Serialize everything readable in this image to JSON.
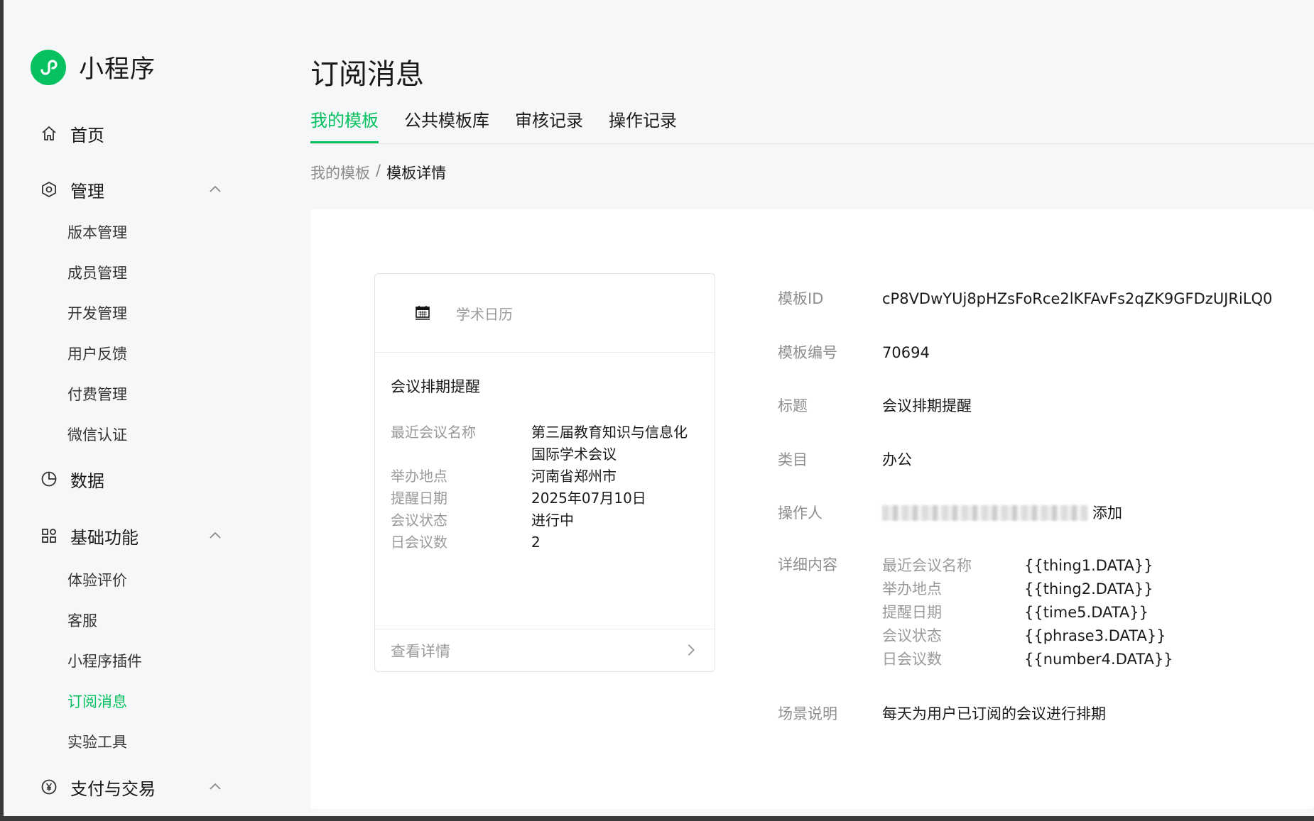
{
  "brand": {
    "name": "小程序",
    "logo_icon": "miniprogram-logo-icon",
    "color": "#07c160"
  },
  "sidebar": {
    "items": [
      {
        "label": "首页",
        "icon": "home-icon"
      },
      {
        "label": "管理",
        "icon": "settings-hexagon-icon",
        "expanded": true,
        "children": [
          "版本管理",
          "成员管理",
          "开发管理",
          "用户反馈",
          "付费管理",
          "微信认证"
        ]
      },
      {
        "label": "数据",
        "icon": "pie-chart-icon"
      },
      {
        "label": "基础功能",
        "icon": "grid-icon",
        "expanded": true,
        "children": [
          "体验评价",
          "客服",
          "小程序插件",
          "订阅消息",
          "实验工具"
        ]
      },
      {
        "label": "支付与交易",
        "icon": "yen-circle-icon",
        "expanded": true
      }
    ],
    "active_child": "订阅消息"
  },
  "page": {
    "title": "订阅消息",
    "tabs": [
      "我的模板",
      "公共模板库",
      "审核记录",
      "操作记录"
    ],
    "active_tab": "我的模板",
    "breadcrumb": {
      "parent": "我的模板",
      "separator": "/",
      "current": "模板详情"
    }
  },
  "card": {
    "app_name": "学术日历",
    "app_icon": "calendar-logo-icon",
    "title": "会议排期提醒",
    "rows": [
      {
        "key": "最近会议名称",
        "value": "第三届教育知识与信息化国际学术会议"
      },
      {
        "key": "举办地点",
        "value": "河南省郑州市"
      },
      {
        "key": "提醒日期",
        "value": "2025年07月10日"
      },
      {
        "key": "会议状态",
        "value": "进行中"
      },
      {
        "key": "日会议数",
        "value": "2"
      }
    ],
    "footer": "查看详情"
  },
  "details": {
    "template_id": {
      "label": "模板ID",
      "value": "cP8VDwYUj8pHZsFoRce2lKFAvFs2qZK9GFDzUJRiLQ0"
    },
    "template_no": {
      "label": "模板编号",
      "value": "70694"
    },
    "title": {
      "label": "标题",
      "value": "会议排期提醒"
    },
    "category": {
      "label": "类目",
      "value": "办公"
    },
    "operator": {
      "label": "操作人",
      "suffix": "添加"
    },
    "content": {
      "label": "详细内容",
      "fields": [
        {
          "key": "最近会议名称",
          "value": "{{thing1.DATA}}"
        },
        {
          "key": "举办地点",
          "value": "{{thing2.DATA}}"
        },
        {
          "key": "提醒日期",
          "value": "{{time5.DATA}}"
        },
        {
          "key": "会议状态",
          "value": "{{phrase3.DATA}}"
        },
        {
          "key": "日会议数",
          "value": "{{number4.DATA}}"
        }
      ]
    },
    "scene": {
      "label": "场景说明",
      "value": "每天为用户已订阅的会议进行排期"
    }
  }
}
